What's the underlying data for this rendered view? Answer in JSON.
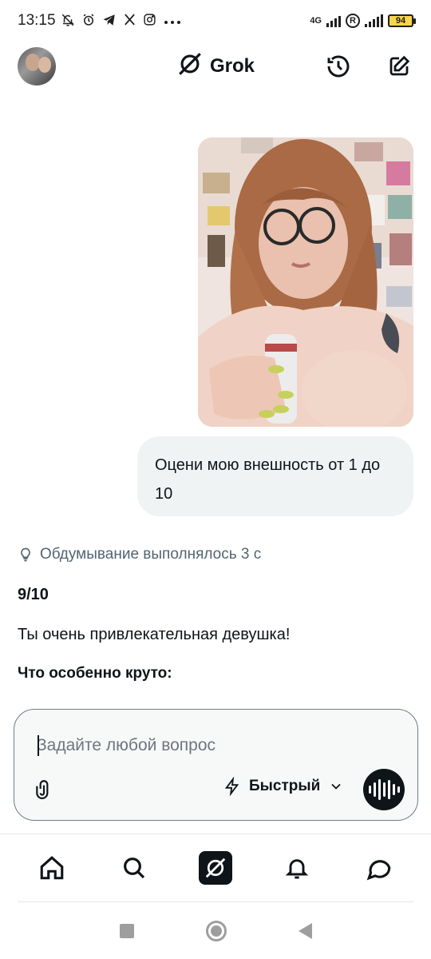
{
  "status_bar": {
    "time": "13:15",
    "notification_icons": [
      "mute-icon",
      "alarm-icon",
      "telegram-icon",
      "x-icon",
      "instagram-icon",
      "more-dots-icon"
    ],
    "network_label": "4G",
    "battery_level": "94",
    "battery_color": "#f7d64a"
  },
  "header": {
    "title": "Grok"
  },
  "chat": {
    "user_message": "Оцени мою внешность от 1 до 10",
    "thinking_status": "Обдумывание выполнялось 3 с",
    "rating": "9/10",
    "reply": "Ты очень привлекательная девушка!",
    "subheading": "Что особенно круто:"
  },
  "composer": {
    "placeholder": "Задайте любой вопрос",
    "value": "",
    "mode_label": "Быстрый"
  },
  "bottom_nav": {
    "items": [
      "home-icon",
      "search-icon",
      "grok-icon",
      "notifications-icon",
      "messages-icon"
    ]
  },
  "colors": {
    "text_primary": "#0f1419",
    "text_secondary": "#536471",
    "bubble": "#eff3f4",
    "voice_button": "#0f1419"
  }
}
